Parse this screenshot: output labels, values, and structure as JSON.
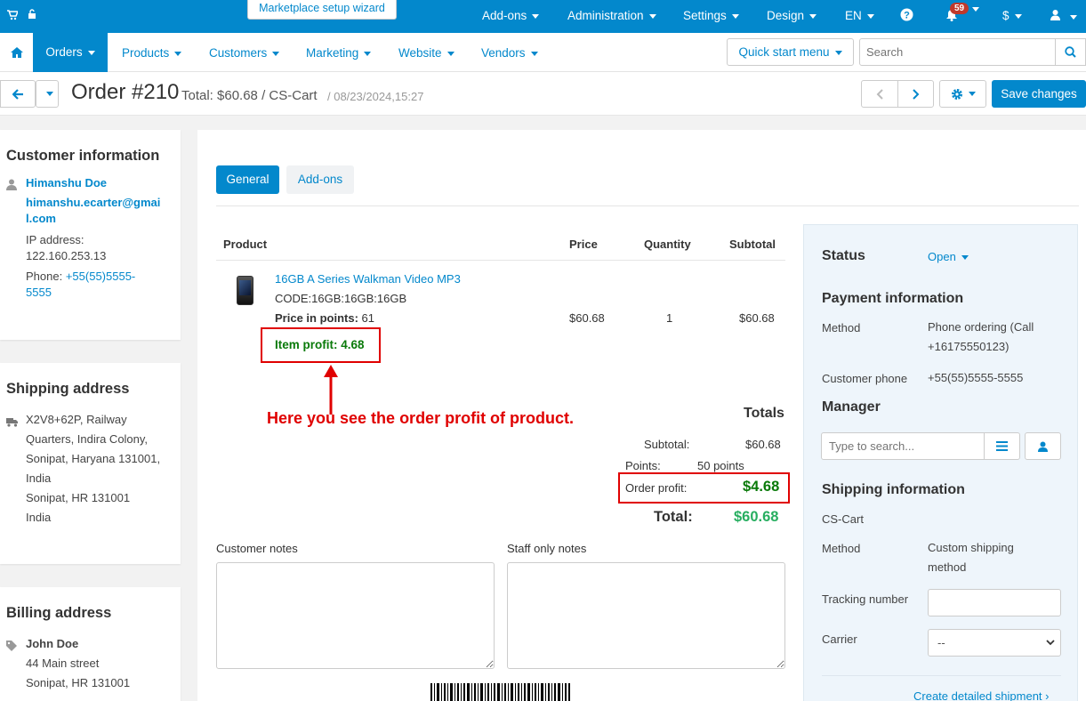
{
  "topbar": {
    "wizard": "Marketplace setup wizard",
    "addons": "Add-ons",
    "administration": "Administration",
    "settings": "Settings",
    "design": "Design",
    "language": "EN",
    "notifications_count": "59",
    "currency": "$"
  },
  "nav": {
    "orders": "Orders",
    "products": "Products",
    "customers": "Customers",
    "marketing": "Marketing",
    "website": "Website",
    "vendors": "Vendors",
    "quick_start": "Quick start menu",
    "search_placeholder": "Search"
  },
  "titlebar": {
    "title": "Order #210",
    "total": "Total: $60.68 / CS-Cart",
    "date": "/ 08/23/2024,15:27",
    "save": "Save changes"
  },
  "customer": {
    "heading": "Customer information",
    "name": "Himanshu Doe",
    "email_line1": "himanshu.ecarter@gmai",
    "email_line2": "l.com",
    "ip_label": "IP address:",
    "ip": "122.160.253.13",
    "phone_label": "Phone:",
    "phone_line1": "+55(55)5555-",
    "phone_line2": "5555"
  },
  "shipping_address": {
    "heading": "Shipping address",
    "lines": [
      "X2V8+62P, Railway",
      "Quarters, Indira Colony,",
      "Sonipat, Haryana 131001,",
      "India",
      "Sonipat, HR 131001",
      "India"
    ]
  },
  "billing_address": {
    "heading": "Billing address",
    "name": "John Doe",
    "lines": [
      "44 Main street",
      "Sonipat, HR 131001"
    ]
  },
  "tabs": {
    "general": "General",
    "addons": "Add-ons"
  },
  "products_table": {
    "headers": {
      "product": "Product",
      "price": "Price",
      "quantity": "Quantity",
      "subtotal": "Subtotal"
    },
    "item": {
      "name": "16GB A Series Walkman Video MP3",
      "code": "CODE:16GB:16GB:16GB",
      "points_label": "Price in points:",
      "points": "61",
      "profit": "Item profit: 4.68",
      "price": "$60.68",
      "quantity": "1",
      "subtotal": "$60.68"
    }
  },
  "annotation": "Here you see the order profit of product.",
  "totals": {
    "heading": "Totals",
    "subtotal_label": "Subtotal:",
    "subtotal": "$60.68",
    "points_label": "Points:",
    "points": "50 points",
    "profit_label": "Order profit:",
    "profit": "$4.68",
    "total_label": "Total:",
    "total": "$60.68"
  },
  "notes": {
    "customer": "Customer notes",
    "staff": "Staff only notes"
  },
  "status_panel": {
    "status_label": "Status",
    "status_value": "Open",
    "payment_heading": "Payment information",
    "method_label": "Method",
    "method_line1": "Phone ordering (Call",
    "method_line2": "+16175550123)",
    "phone_label": "Customer phone",
    "phone_value": "+55(55)5555-5555",
    "manager_heading": "Manager",
    "manager_placeholder": "Type to search...",
    "shipping_heading": "Shipping information",
    "carrier_name": "CS-Cart",
    "ship_method_label": "Method",
    "ship_method_line1": "Custom shipping",
    "ship_method_line2": "method",
    "tracking_label": "Tracking number",
    "carrier_label": "Carrier",
    "carrier_value": "--",
    "create_shipment": "Create detailed shipment ›"
  },
  "colors": {
    "primary": "#0388cc",
    "profit_green": "#0a7a0a",
    "total_green": "#27ae60",
    "highlight_red": "#e00000"
  }
}
